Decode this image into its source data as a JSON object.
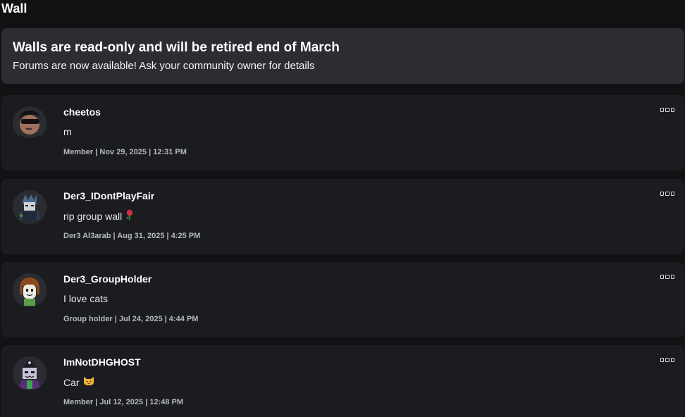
{
  "page": {
    "title": "Wall"
  },
  "notice": {
    "title": "Walls are read-only and will be retired end of March",
    "body": "Forums are now available! Ask your community owner for details"
  },
  "posts": [
    {
      "username": "cheetos",
      "message": "m",
      "meta": "Member | Nov 29, 2025 | 12:31 PM",
      "emoji": ""
    },
    {
      "username": "Der3_IDontPlayFair",
      "message": "rip group wall",
      "meta": "Der3 Al3arab | Aug 31, 2025 | 4:25 PM",
      "emoji": "rose-icon"
    },
    {
      "username": "Der3_GroupHolder",
      "message": "I love cats",
      "meta": "Group holder | Jul 24, 2025 | 4:44 PM",
      "emoji": ""
    },
    {
      "username": "ImNotDHGHOST",
      "message": "Car",
      "meta": "Member | Jul 12, 2025 | 12:48 PM",
      "emoji": "cat-face-icon"
    }
  ],
  "colors": {
    "background": "#111214",
    "notice_bg": "#2c2d32",
    "post_bg": "#1b1c20",
    "meta_text": "#b6b9c0"
  }
}
